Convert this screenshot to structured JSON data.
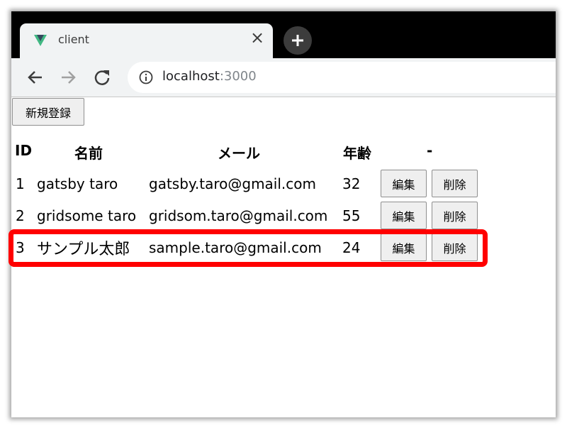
{
  "browser": {
    "tab_title": "client",
    "close_glyph": "×",
    "new_tab_glyph": "+",
    "url_host": "localhost",
    "url_port": ":3000"
  },
  "page": {
    "new_button": "新規登録",
    "headers": {
      "id": "ID",
      "name": "名前",
      "mail": "メール",
      "age": "年齢",
      "action": "-"
    },
    "rows": [
      {
        "id": "1",
        "name": "gatsby taro",
        "mail": "gatsby.taro@gmail.com",
        "age": "32",
        "edit": "編集",
        "delete": "削除"
      },
      {
        "id": "2",
        "name": "gridsome taro",
        "mail": "gridsom.taro@gmail.com",
        "age": "55",
        "edit": "編集",
        "delete": "削除"
      },
      {
        "id": "3",
        "name": "サンプル太郎",
        "mail": "sample.taro@gmail.com",
        "age": "24",
        "edit": "編集",
        "delete": "削除"
      }
    ]
  },
  "colors": {
    "highlight": "#ff0000",
    "chrome_dark": "#000000",
    "chrome_light": "#f1f3f4"
  },
  "icons": [
    "vue-logo-icon",
    "close-icon",
    "plus-icon",
    "back-arrow-icon",
    "forward-arrow-icon",
    "reload-icon",
    "info-icon"
  ]
}
